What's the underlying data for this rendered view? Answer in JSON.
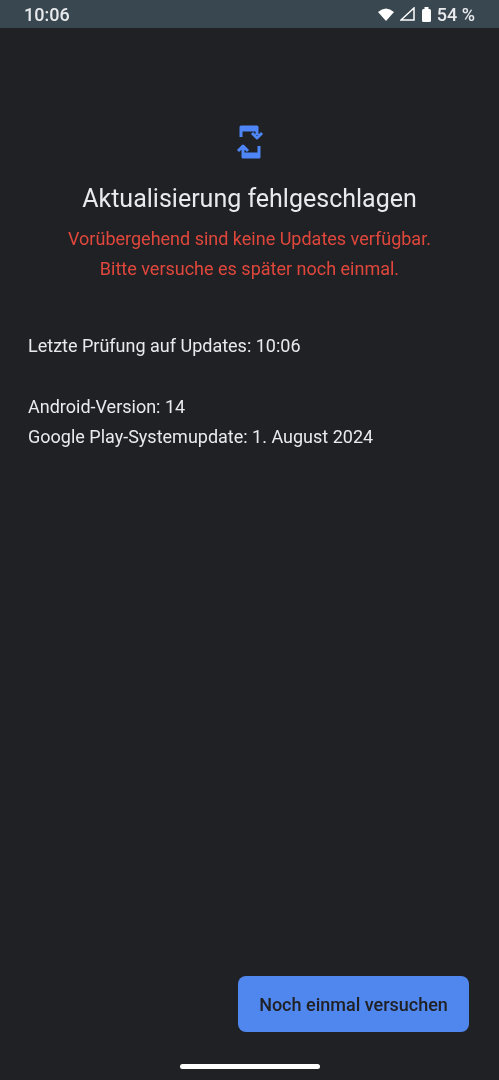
{
  "status_bar": {
    "time": "10:06",
    "battery": "54 %"
  },
  "title": "Aktualisierung fehlgeschlagen",
  "error_lines": [
    "Vorübergehend sind keine Updates verfügbar.",
    "Bitte versuche es später noch einmal."
  ],
  "last_check": "Letzte Prüfung auf Updates: 10:06",
  "info_lines": [
    "Android-Version: 14",
    "Google Play-Systemupdate: 1. August 2024"
  ],
  "button": "Noch einmal versuchen"
}
